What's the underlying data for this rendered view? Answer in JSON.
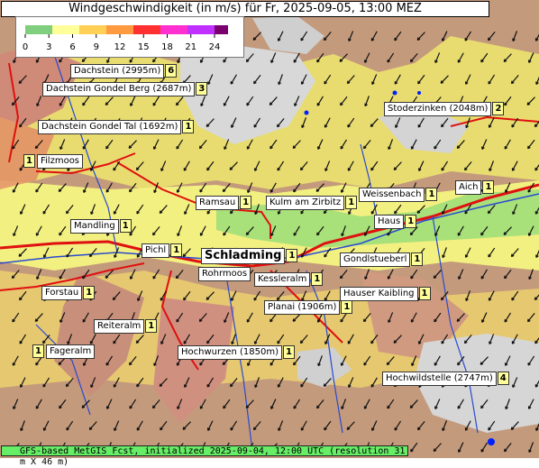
{
  "title": "Windgeschwindigkeit (in m/s) für Fr, 2025-09-05, 13:00 MEZ",
  "legend": {
    "ticks": [
      "0",
      "3",
      "6",
      "9",
      "12",
      "15",
      "18",
      "21",
      "24"
    ],
    "colors": [
      "#7fcf7f",
      "#ffff99",
      "#ffd055",
      "#ff9a40",
      "#ff3030",
      "#ff30d0",
      "#c030ff",
      "#7a0070"
    ]
  },
  "places": [
    {
      "id": "dachstein",
      "name": "Dachstein (2995m)",
      "value": "6"
    },
    {
      "id": "dachstein-gondel-berg",
      "name": "Dachstein Gondel Berg (2687m)",
      "value": "3"
    },
    {
      "id": "stoderzinken",
      "name": "Stoderzinken (2048m)",
      "value": "2"
    },
    {
      "id": "dachstein-gondel-tal",
      "name": "Dachstein Gondel Tal (1692m)",
      "value": "1"
    },
    {
      "id": "filzmoos",
      "name": "Filzmoos",
      "value": "1"
    },
    {
      "id": "aich",
      "name": "Aich",
      "value": "1"
    },
    {
      "id": "weissenbach",
      "name": "Weissenbach",
      "value": "1"
    },
    {
      "id": "ramsau",
      "name": "Ramsau",
      "value": "1"
    },
    {
      "id": "kulm",
      "name": "Kulm am Zirbitz",
      "value": "1"
    },
    {
      "id": "haus",
      "name": "Haus",
      "value": "1"
    },
    {
      "id": "mandling",
      "name": "Mandling",
      "value": "1"
    },
    {
      "id": "pichl",
      "name": "Pichl",
      "value": "1"
    },
    {
      "id": "schladming",
      "name": "Schladming",
      "value": "1"
    },
    {
      "id": "gondlstueberl",
      "name": "Gondlstueberl",
      "value": "1"
    },
    {
      "id": "rohrmoos",
      "name": "Rohrmoos",
      "value": ""
    },
    {
      "id": "kesslerialm",
      "name": "Kessleralm",
      "value": "1"
    },
    {
      "id": "forstau",
      "name": "Forstau",
      "value": "1"
    },
    {
      "id": "hauser-kaibling",
      "name": "Hauser Kaibling",
      "value": "1"
    },
    {
      "id": "planai",
      "name": "Planai (1906m)",
      "value": "1"
    },
    {
      "id": "reiteralm",
      "name": "Reiteralm",
      "value": "1"
    },
    {
      "id": "fageralm",
      "name": "Fageralm",
      "value": "1"
    },
    {
      "id": "hochwurzen",
      "name": "Hochwurzen (1850m)",
      "value": "1"
    },
    {
      "id": "hochwildstelle",
      "name": "Hochwildstelle (2747m)",
      "value": "4"
    }
  ],
  "footer": "GFS-based MetGIS Fcst, initialized 2025-09-04, 12:00 UTC  (resolution 31 m X 46 m)"
}
